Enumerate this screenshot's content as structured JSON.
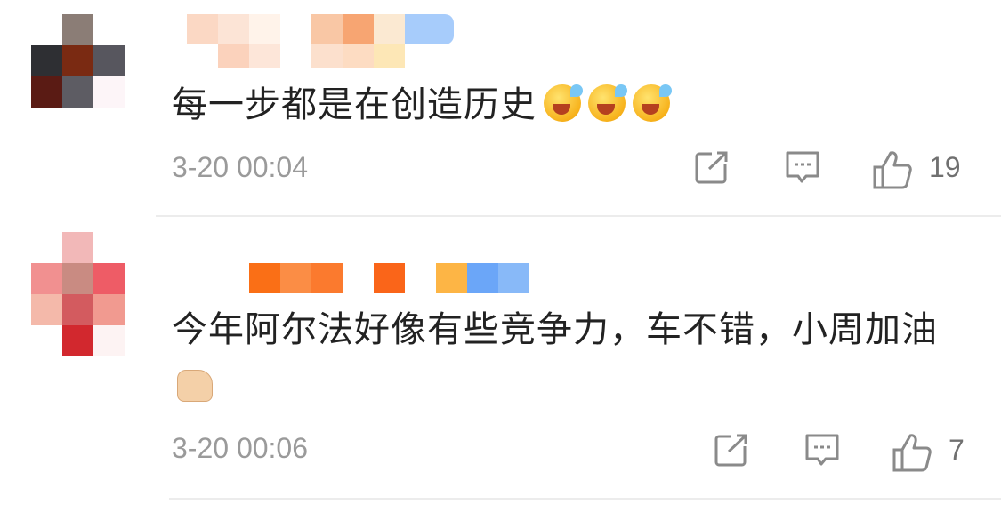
{
  "comments": [
    {
      "text": "每一步都是在创造历史",
      "emoji_count": 3,
      "time": "3-20 00:04",
      "like_count": "19",
      "avatar_colors": [
        "#ffffff",
        "#7a6f6a",
        "#ffffff",
        "#2e2f33",
        "#7a2a12",
        "#57565e",
        "#5a1b14",
        "#5d5c63",
        "#fdf5f8"
      ],
      "username_colors": [
        "#fbd8c4",
        "#ffffff",
        "#f9c7a5",
        "#fbe1cf",
        "#a7ccfb"
      ]
    },
    {
      "text": "今年阿尔法好像有些竞争力，车不错，小周加油",
      "emoji_count": 1,
      "time": "3-20 00:06",
      "like_count": "7",
      "avatar_colors": [
        "#ffffff",
        "#f2b8b8",
        "#ffffff",
        "#f19090",
        "#c98b82",
        "#ee5c66",
        "#f4b9aa",
        "#d35b5f",
        "#f19a90"
      ],
      "avatar_bottom": "#d2282e",
      "username_colors": [
        "#fa6f16",
        "#fb8d45",
        "#ffffff",
        "#fa6519",
        "#ffffff",
        "#fdb545",
        "#6ba6f8",
        "#88b9f8"
      ]
    }
  ],
  "icons": {
    "share": "share-icon",
    "comment": "comment-icon",
    "like": "thumbs-up-icon",
    "emoji1": "crying-laughing-emoji",
    "emoji2": "thumbs-up-emoji"
  },
  "colors": {
    "text": "#222222",
    "meta": "#9a9a9a",
    "icon": "#8a8a8a",
    "divider": "#ececec"
  }
}
